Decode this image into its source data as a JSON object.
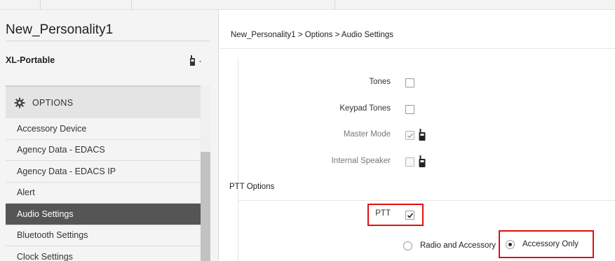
{
  "personality": {
    "title": "New_Personality1"
  },
  "device": {
    "name": "XL-Portable",
    "icon": "portable-radio-icon"
  },
  "menu": {
    "header_label": "OPTIONS",
    "header_icon": "gear-icon",
    "items": [
      {
        "label": "Accessory Device"
      },
      {
        "label": "Agency Data - EDACS"
      },
      {
        "label": "Agency Data - EDACS IP"
      },
      {
        "label": "Alert"
      },
      {
        "label": "Audio Settings",
        "selected": true
      },
      {
        "label": "Bluetooth Settings"
      },
      {
        "label": "Clock Settings"
      }
    ]
  },
  "breadcrumb": "New_Personality1 > Options > Audio Settings",
  "fields": {
    "tones": {
      "label": "Tones",
      "checked": false
    },
    "keypad_tones": {
      "label": "Keypad Tones",
      "checked": false
    },
    "master_mode": {
      "label": "Master Mode",
      "checked": true,
      "disabled": true,
      "icon": "portable-radio-icon"
    },
    "internal_speaker": {
      "label": "Internal Speaker",
      "checked": false,
      "disabled": true,
      "icon": "portable-radio-icon"
    }
  },
  "ptt_section": {
    "title": "PTT Options",
    "ptt": {
      "label": "PTT",
      "checked": true
    },
    "options": [
      {
        "label": "Radio and Accessory",
        "selected": false
      },
      {
        "label": "Accessory Only",
        "selected": true
      }
    ]
  },
  "colors": {
    "active_menu_bg": "#555555",
    "highlight_red": "#e01010"
  }
}
